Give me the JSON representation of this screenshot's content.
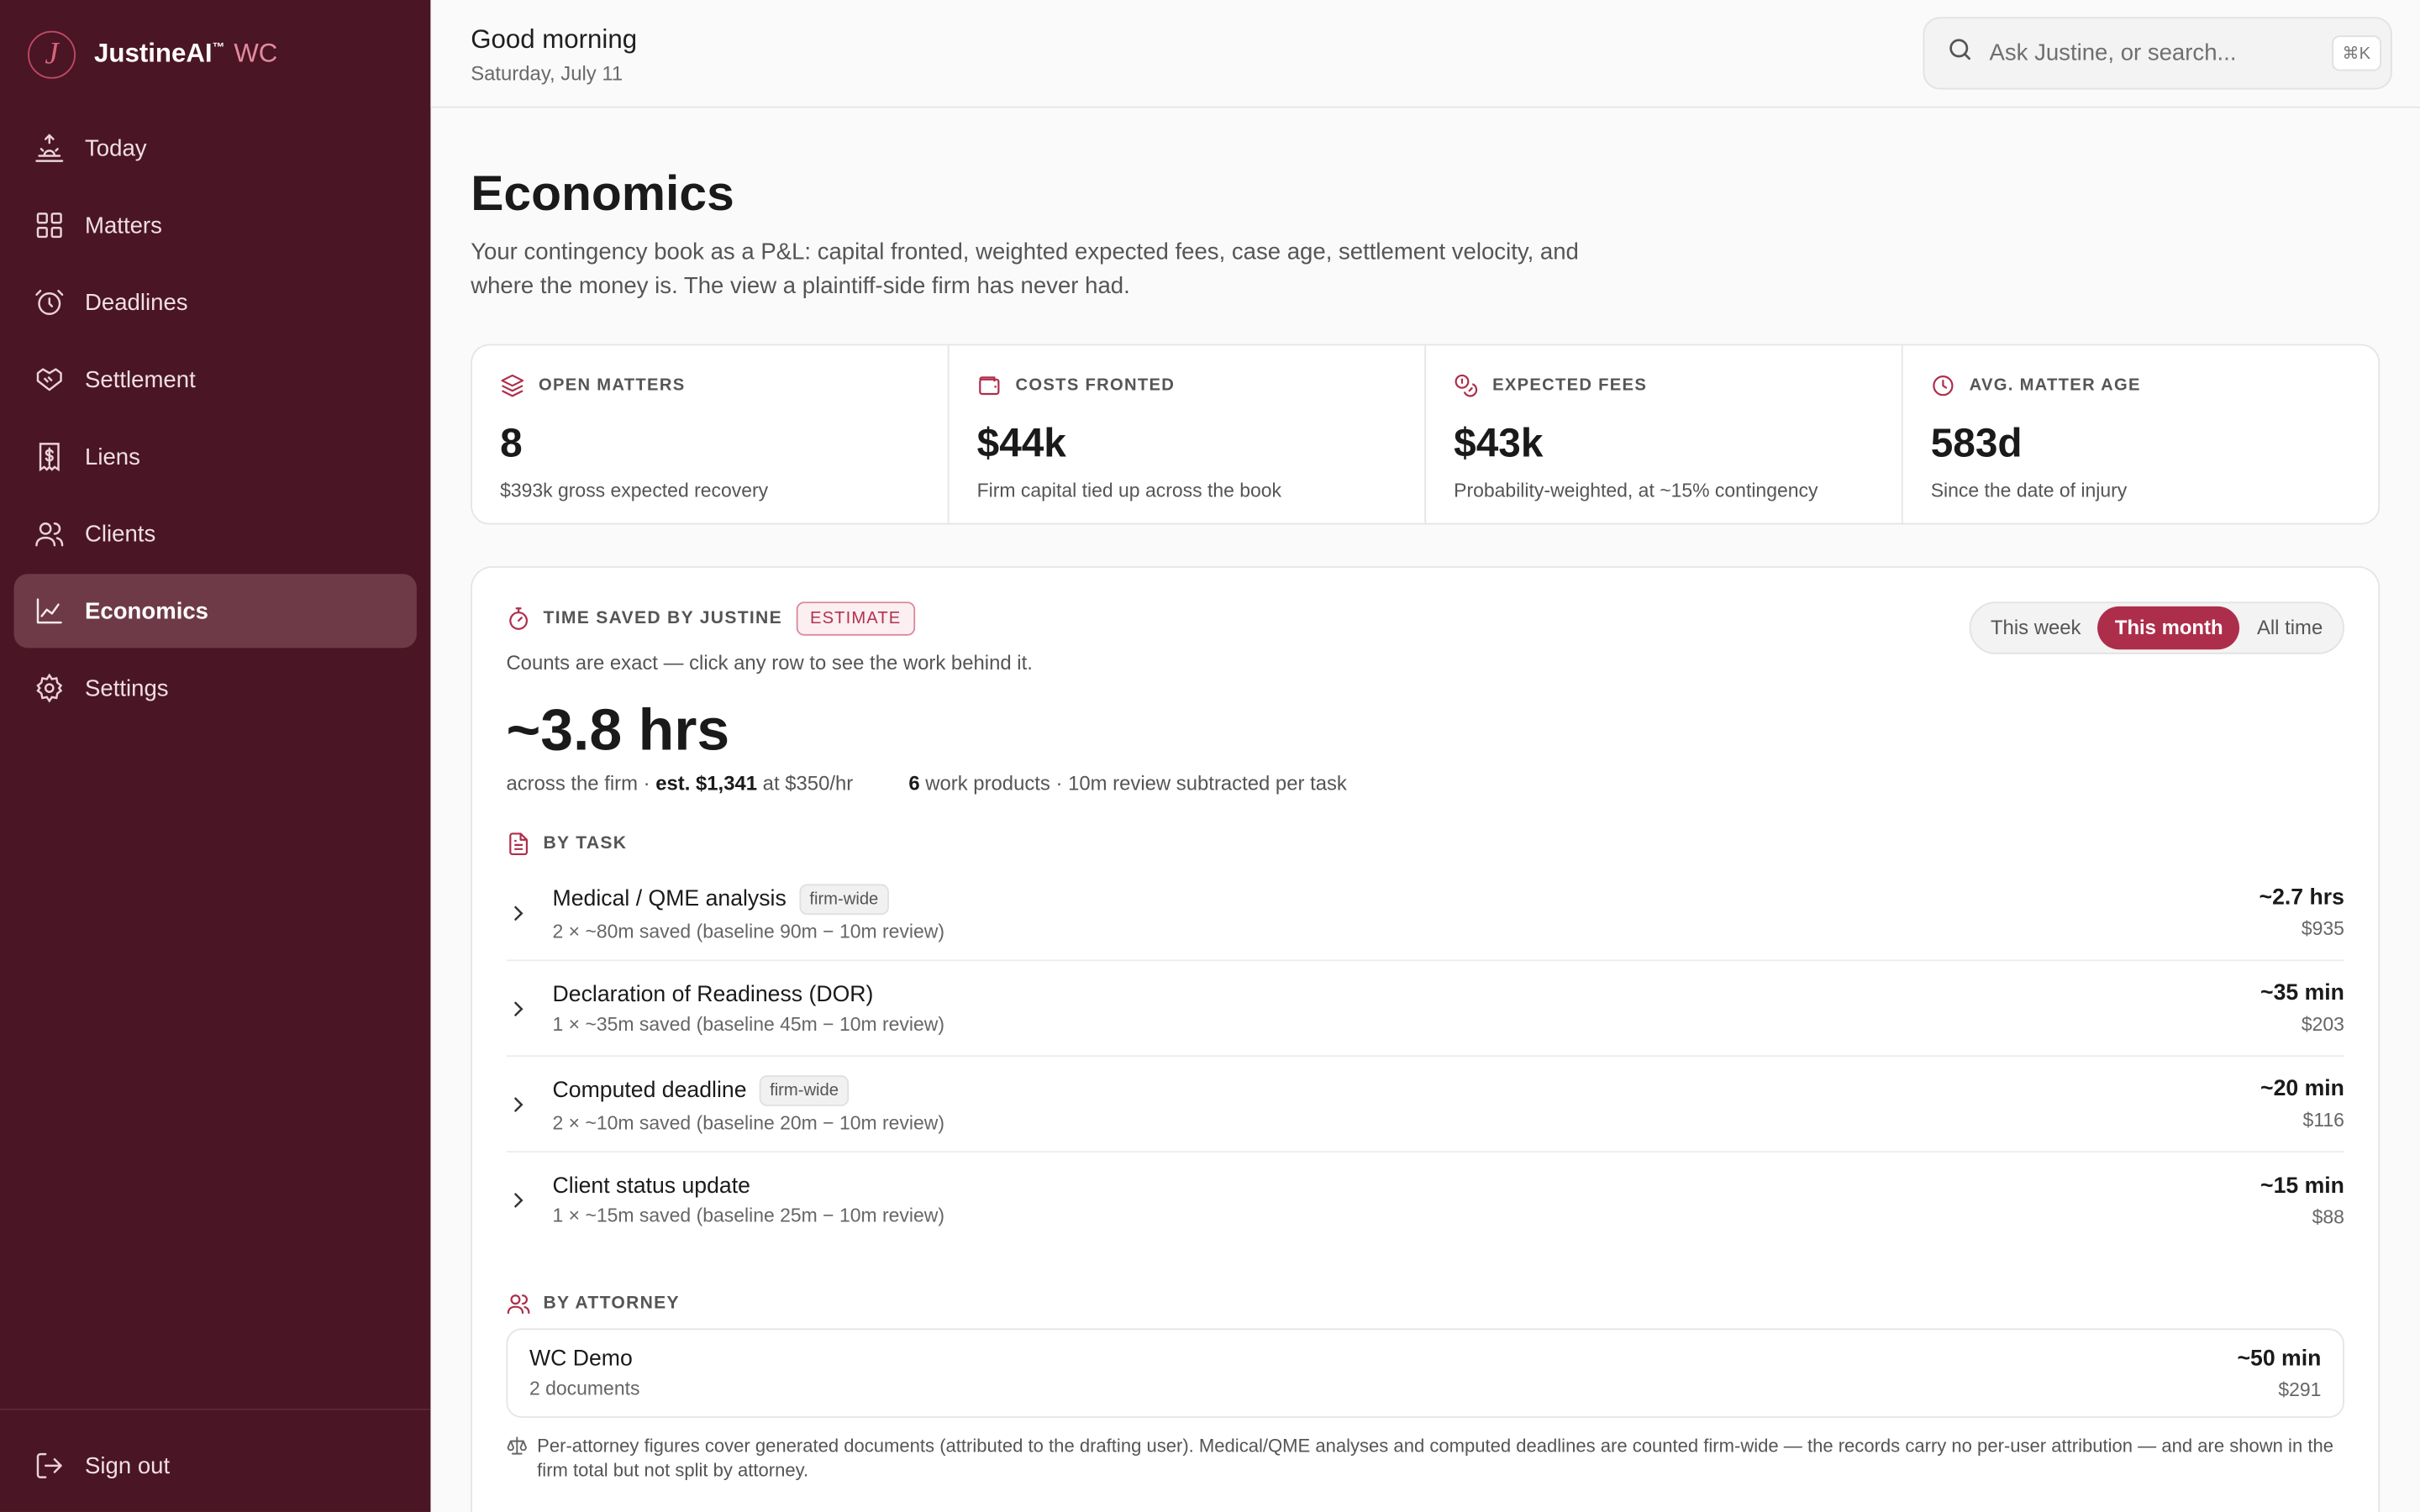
{
  "brand": {
    "name": "JustineAI",
    "tm": "™",
    "suffix": "WC",
    "logo_letter": "J"
  },
  "sidebar": {
    "items": [
      {
        "label": "Today",
        "icon": "sunrise-icon"
      },
      {
        "label": "Matters",
        "icon": "grid-icon"
      },
      {
        "label": "Deadlines",
        "icon": "alarm-clock-icon"
      },
      {
        "label": "Settlement",
        "icon": "handshake-icon"
      },
      {
        "label": "Liens",
        "icon": "receipt-dollar-icon"
      },
      {
        "label": "Clients",
        "icon": "users-icon"
      },
      {
        "label": "Economics",
        "icon": "line-chart-icon",
        "active": true
      },
      {
        "label": "Settings",
        "icon": "gear-icon"
      }
    ],
    "signout": "Sign out"
  },
  "header": {
    "greeting": "Good morning",
    "date": "Saturday, July 11",
    "search_placeholder": "Ask Justine, or search...",
    "search_shortcut": "⌘K"
  },
  "page": {
    "title": "Economics",
    "subtitle": "Your contingency book as a P&L: capital fronted, weighted expected fees, case age, settlement velocity, and where the money is. The view a plaintiff-side firm has never had."
  },
  "stats": [
    {
      "label": "OPEN MATTERS",
      "value": "8",
      "desc": "$393k gross expected recovery",
      "icon": "layers-icon"
    },
    {
      "label": "COSTS FRONTED",
      "value": "$44k",
      "desc": "Firm capital tied up across the book",
      "icon": "wallet-icon"
    },
    {
      "label": "EXPECTED FEES",
      "value": "$43k",
      "desc": "Probability-weighted, at ~15% contingency",
      "icon": "coins-icon"
    },
    {
      "label": "AVG. MATTER AGE",
      "value": "583d",
      "desc": "Since the date of injury",
      "icon": "clock-icon"
    }
  ],
  "time_saved": {
    "title": "TIME SAVED BY JUSTINE",
    "badge": "ESTIMATE",
    "counts_note": "Counts are exact — click any row to see the work behind it.",
    "range_options": [
      "This week",
      "This month",
      "All time"
    ],
    "range_selected": "This month",
    "total": "~3.8 hrs",
    "sub_prefix": "across the firm · ",
    "sub_est": "est. $1,341",
    "sub_rate": " at $350/hr",
    "work_count": "6",
    "work_note": " work products · 10m review subtracted per task",
    "by_task_label": "BY TASK",
    "tasks": [
      {
        "name": "Medical / QME analysis",
        "tag": "firm-wide",
        "detail": "2 × ~80m saved (baseline 90m − 10m review)",
        "time": "~2.7 hrs",
        "value": "$935"
      },
      {
        "name": "Declaration of Readiness (DOR)",
        "tag": "",
        "detail": "1 × ~35m saved (baseline 45m − 10m review)",
        "time": "~35 min",
        "value": "$203"
      },
      {
        "name": "Computed deadline",
        "tag": "firm-wide",
        "detail": "2 × ~10m saved (baseline 20m − 10m review)",
        "time": "~20 min",
        "value": "$116"
      },
      {
        "name": "Client status update",
        "tag": "",
        "detail": "1 × ~15m saved (baseline 25m − 10m review)",
        "time": "~15 min",
        "value": "$88"
      }
    ],
    "by_attorney_label": "BY ATTORNEY",
    "attorneys": [
      {
        "name": "WC Demo",
        "docs": "2 documents",
        "time": "~50 min",
        "value": "$291"
      }
    ],
    "footnote": "Per-attorney figures cover generated documents (attributed to the drafting user). Medical/QME analyses and computed deadlines are counted firm-wide — the records carry no per-user attribution — and are shown in the firm total but not split by attorney."
  },
  "colors": {
    "sidebar_bg": "#4a1524",
    "accent": "#ad2e4b",
    "active_nav": "#6e3a48"
  }
}
